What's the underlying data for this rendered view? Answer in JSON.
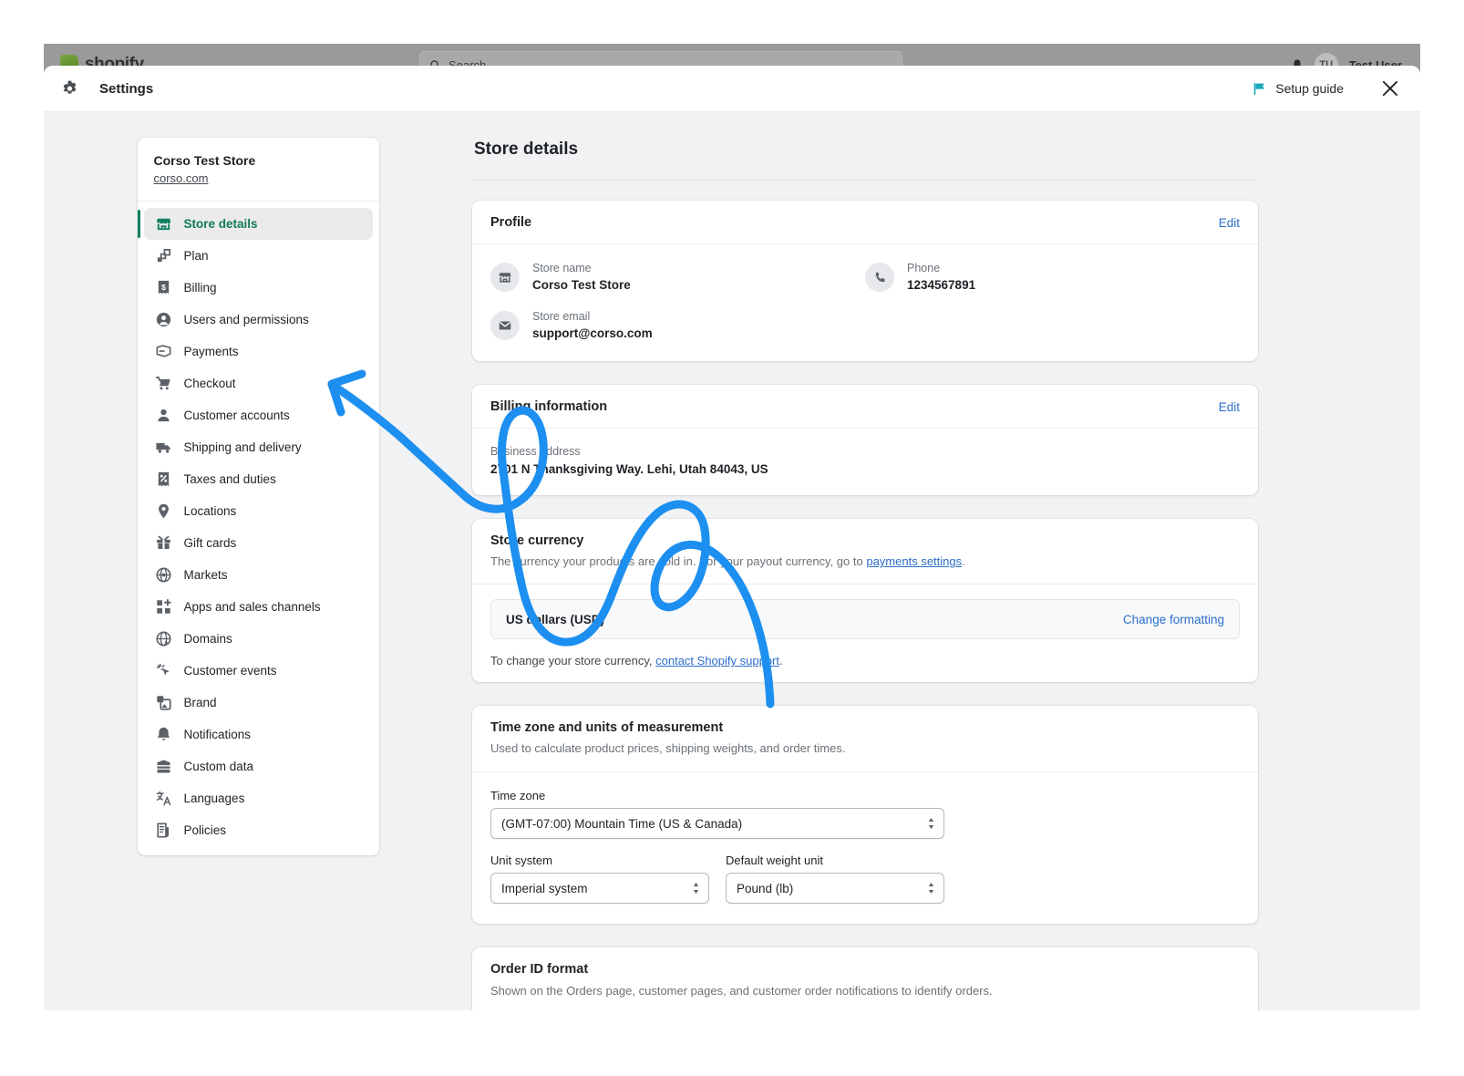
{
  "backdrop": {
    "brand": "shopify",
    "search_placeholder": "Search",
    "user_initials": "TU",
    "user_name": "Test User"
  },
  "header": {
    "title": "Settings",
    "gear_icon": "gear-icon",
    "setup_guide_label": "Setup guide",
    "flag_icon": "flag-icon",
    "flag_color": "#1aa7b8",
    "close_icon": "close-icon"
  },
  "sidebar": {
    "store_name": "Corso Test Store",
    "store_url": "corso.com",
    "items": [
      {
        "label": "Store details",
        "icon": "store-icon",
        "active": true
      },
      {
        "label": "Plan",
        "icon": "plan-icon",
        "active": false
      },
      {
        "label": "Billing",
        "icon": "billing-icon",
        "active": false
      },
      {
        "label": "Users and permissions",
        "icon": "user-circle-icon",
        "active": false
      },
      {
        "label": "Payments",
        "icon": "payments-icon",
        "active": false
      },
      {
        "label": "Checkout",
        "icon": "cart-icon",
        "active": false
      },
      {
        "label": "Customer accounts",
        "icon": "person-icon",
        "active": false
      },
      {
        "label": "Shipping and delivery",
        "icon": "truck-icon",
        "active": false
      },
      {
        "label": "Taxes and duties",
        "icon": "percent-receipt-icon",
        "active": false
      },
      {
        "label": "Locations",
        "icon": "location-pin-icon",
        "active": false
      },
      {
        "label": "Gift cards",
        "icon": "gift-icon",
        "active": false
      },
      {
        "label": "Markets",
        "icon": "globe-markets-icon",
        "active": false
      },
      {
        "label": "Apps and sales channels",
        "icon": "apps-plus-icon",
        "active": false
      },
      {
        "label": "Domains",
        "icon": "globe-icon",
        "active": false
      },
      {
        "label": "Customer events",
        "icon": "cursor-click-icon",
        "active": false
      },
      {
        "label": "Brand",
        "icon": "image-icon",
        "active": false
      },
      {
        "label": "Notifications",
        "icon": "bell-icon",
        "active": false
      },
      {
        "label": "Custom data",
        "icon": "database-icon",
        "active": false
      },
      {
        "label": "Languages",
        "icon": "translate-icon",
        "active": false
      },
      {
        "label": "Policies",
        "icon": "document-icon",
        "active": false
      }
    ],
    "active_color": "#12795a"
  },
  "main": {
    "page_title": "Store details",
    "profile": {
      "title": "Profile",
      "edit_label": "Edit",
      "store_name_label": "Store name",
      "store_name_value": "Corso Test Store",
      "store_email_label": "Store email",
      "store_email_value": "support@corso.com",
      "phone_label": "Phone",
      "phone_value": "1234567891"
    },
    "billing": {
      "title": "Billing information",
      "edit_label": "Edit",
      "address_label": "Business address",
      "address_value": "2701 N Thanksgiving Way. Lehi, Utah 84043, US"
    },
    "currency": {
      "title": "Store currency",
      "description_before": "The currency your products are sold in. For your payout currency, go to ",
      "description_link": "payments settings",
      "description_after": ".",
      "value": "US dollars (USD)",
      "change_formatting_label": "Change formatting",
      "note_before": "To change your store currency, ",
      "note_link": "contact Shopify support",
      "note_after": "."
    },
    "timezone": {
      "title": "Time zone and units of measurement",
      "description": "Used to calculate product prices, shipping weights, and order times.",
      "timezone_label": "Time zone",
      "timezone_value": "(GMT-07:00) Mountain Time (US & Canada)",
      "unit_system_label": "Unit system",
      "unit_system_value": "Imperial system",
      "weight_unit_label": "Default weight unit",
      "weight_unit_value": "Pound (lb)"
    },
    "order_id": {
      "title": "Order ID format",
      "description": "Shown on the Orders page, customer pages, and customer order notifications to identify orders."
    }
  },
  "annotation": {
    "type": "hand-drawn-arrow",
    "color": "#1c8ff0",
    "points_to": "Checkout"
  }
}
